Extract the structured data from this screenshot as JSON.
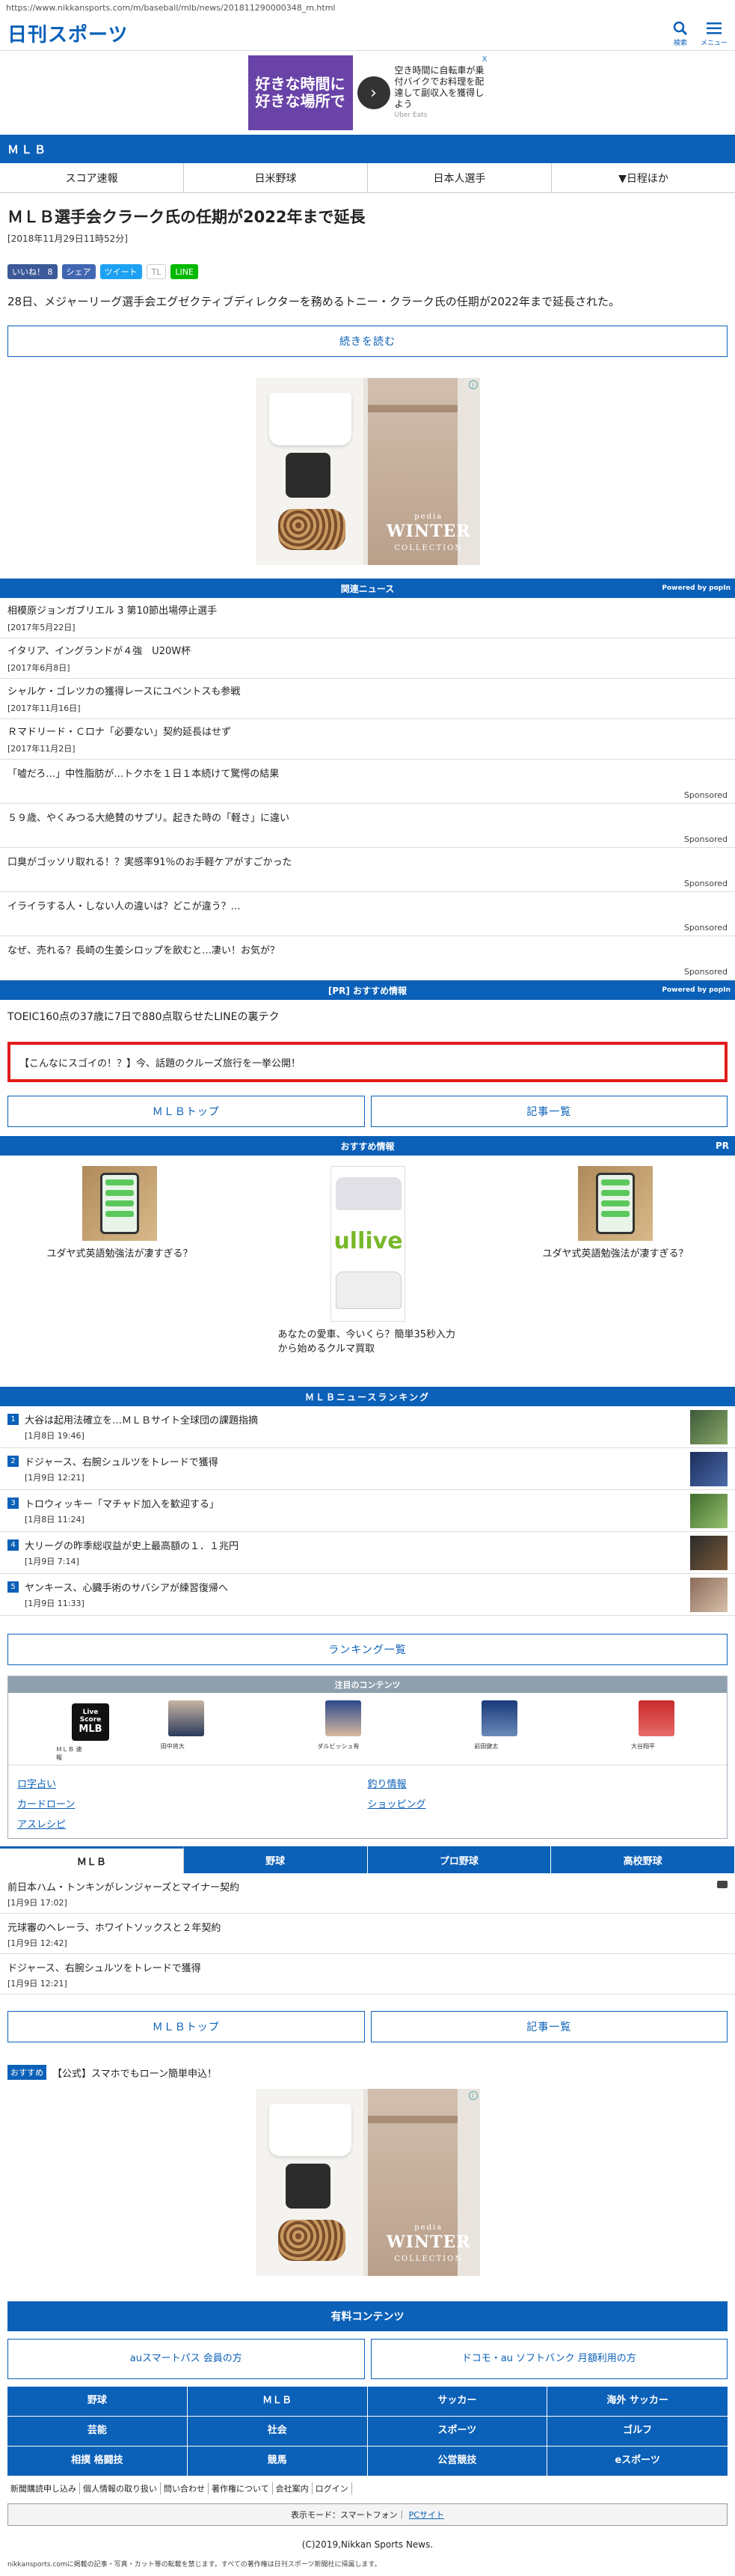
{
  "url": "https://www.nikkansports.com/m/baseball/mlb/news/201811290000348_m.html",
  "header": {
    "logo": "日刊スポーツ",
    "search_label": "検索",
    "menu_label": "メニュー"
  },
  "top_ad": {
    "left_text": "好きな時間に 好きな場所で",
    "right_text": "空き時間に自転車が乗付バイクでお料理を配達して副収入を獲得しよう",
    "sponsor": "Uber Eats",
    "close": "X"
  },
  "section": {
    "title": "ＭＬＢ"
  },
  "tabs": [
    "スコア速報",
    "日米野球",
    "日本人選手",
    "▼日程ほか"
  ],
  "article": {
    "title": "ＭＬＢ選手会クラーク氏の任期が2022年まで延長",
    "date": "[2018年11月29日11時52分]",
    "lead": "28日、メジャーリーグ選手会エグゼクティブディレクターを務めるトニー・クラーク氏の任期が2022年まで延長された。",
    "read_more": "続きを読む"
  },
  "share": {
    "like": "いいね！ 8",
    "share": "シェア",
    "tweet": "ツイート",
    "tl": "TL",
    "line": "LINE"
  },
  "ad_mid": {
    "title": "WINTER",
    "subtitle": "COLLECTION",
    "brand": "pedia"
  },
  "related": {
    "head": "関連ニュース",
    "powered": "Powered by popIn",
    "items": [
      {
        "title": "相模原ジョンガブリエル 3 第10節出場停止選手",
        "date": "[2017年5月22日]"
      },
      {
        "title": "イタリア、イングランドが４強　U20W杯",
        "date": "[2017年6月8日]"
      },
      {
        "title": "シャルケ・ゴレツカの獲得レースにユベントスも参戦",
        "date": "[2017年11月16日]"
      },
      {
        "title": "Ｒマドリード・Ｃロナ「必要ない」契約延長はせず",
        "date": "[2017年11月2日]"
      }
    ],
    "sponsored": [
      {
        "title": "「嘘だろ…」中性脂肪が…トクホを１日１本続けて驚愕の結果",
        "label": "Sponsored"
      },
      {
        "title": "５９歳、やくみつる大絶賛のサプリ。起きた時の「軽さ」に違い",
        "label": "Sponsored"
      },
      {
        "title": "口臭がゴッソリ取れる！？実感率91％のお手軽ケアがすごかった",
        "label": "Sponsored"
      },
      {
        "title": "イライラする人・しない人の違いは？どこが違う？…",
        "label": "Sponsored"
      },
      {
        "title": "なぜ、売れる？長崎の生姜シロップを飲むと…凄い！お気が？",
        "label": "Sponsored"
      }
    ]
  },
  "pr": {
    "head": "[PR] おすすめ情報",
    "powered": "Powered by popIn",
    "text": "TOEIC160点の37歳に7日で880点取らせたLINEの裏テク",
    "highlight": "【こんなにスゴイの！？】今、話題のクルーズ旅行を一挙公開！"
  },
  "nav_buttons": {
    "mlb_top": "ＭＬＢトップ",
    "article_list": "記事一覧"
  },
  "osusume": {
    "head": "おすすめ情報",
    "pr": "PR",
    "items": [
      "ユダヤ式英語勉強法が凄すぎる？",
      "あなたの愛車、今いくら？簡単35秒入力から始めるクルマ買取",
      "ユダヤ式英語勉強法が凄すぎる？"
    ],
    "car_brand": "ullive"
  },
  "ranking": {
    "head": "ＭＬＢニュースランキング",
    "items": [
      {
        "num": "1",
        "title": "大谷は起用法確立を…ＭＬＢサイト全球団の課題指摘",
        "date": "[1月8日 19:46]"
      },
      {
        "num": "2",
        "title": "ドジャース、右腕シュルツをトレードで獲得",
        "date": "[1月9日 12:21]"
      },
      {
        "num": "3",
        "title": "トロウィッキー「マチャド加入を歓迎する」",
        "date": "[1月8日 11:24]"
      },
      {
        "num": "4",
        "title": "大リーグの昨季総収益が史上最高額の１．１兆円",
        "date": "[1月9日 7:14]"
      },
      {
        "num": "5",
        "title": "ヤンキース、心臓手術のサバシアが練習復帰へ",
        "date": "[1月9日 11:33]"
      }
    ],
    "more": "ランキング一覧"
  },
  "featured": {
    "head": "注目のコンテンツ",
    "live": {
      "line1": "Live",
      "line2": "Score",
      "line3": "MLB"
    },
    "players": [
      "ＭＬＢ 速報",
      "田中将大",
      "ダルビッシュ有",
      "前田健太",
      "大谷翔平"
    ],
    "links": [
      "ロ字占い",
      "釣り情報",
      "カードローン",
      "ショッピング",
      "アスレシピ"
    ]
  },
  "cat_tabs": [
    "ＭＬＢ",
    "野球",
    "プロ野球",
    "高校野球"
  ],
  "mlb_news": [
    {
      "title": "前日本ハム・トンキンがレンジャーズとマイナー契約",
      "date": "[1月9日 17:02]"
    },
    {
      "title": "元球審のヘレーラ、ホワイトソックスと２年契約",
      "date": "[1月9日 12:42]"
    },
    {
      "title": "ドジャース、右腕シュルツをトレードで獲得",
      "date": "[1月9日 12:21]"
    }
  ],
  "osusume_line": {
    "tag": "おすすめ",
    "text": "【公式】スマホでもローン簡単申込！"
  },
  "paid": {
    "head": "有料コンテンツ",
    "left": "auスマートパス 会員の方",
    "right": "ドコモ・au ソフトバンク 月額利用の方"
  },
  "categories": [
    "野球",
    "ＭＬＢ",
    "サッカー",
    "海外 サッカー",
    "芸能",
    "社会",
    "スポーツ",
    "ゴルフ",
    "相撲 格闘技",
    "競馬",
    "公営競技",
    "eスポーツ"
  ],
  "footer": {
    "links": [
      "新聞購読申し込み",
      "個人情報の取り扱い",
      "問い合わせ",
      "著作権について",
      "会社案内",
      "ログイン"
    ],
    "display_mode": "表示モード：スマートフォン｜",
    "pc_site": "PCサイト",
    "copyright": "(C)2019,Nikkan Sports News.",
    "disclaimer": "nikkansports.comに掲載の記事・写真・カット等の転載を禁じます。すべての著作権は日刊スポーツ新聞社に帰属します。"
  },
  "colors": {
    "brand_blue": "#0b60b8",
    "highlight_red": "#e31b1b"
  }
}
